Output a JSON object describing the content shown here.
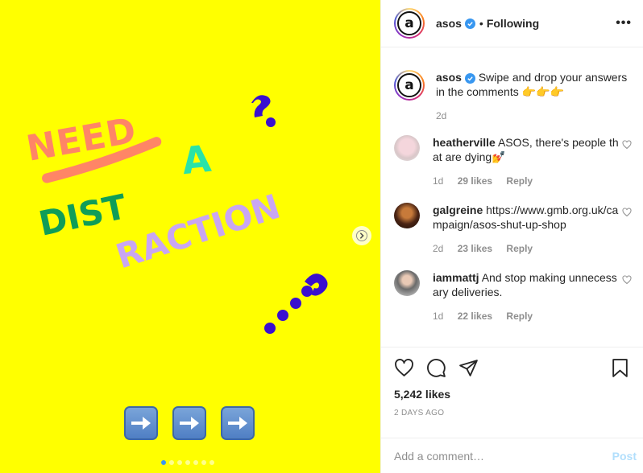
{
  "colors": {
    "media_bg": "#ffff00",
    "need": "#ff8566",
    "a": "#29e3a8",
    "dist": "#0f9d58",
    "raction": "#c9a6f2",
    "marks": "#3a0fcf",
    "link_blue": "#3897f0"
  },
  "media": {
    "words": [
      "NEED",
      "A",
      "DIST",
      "RACTION"
    ],
    "next_icon": "chevron-right-icon",
    "arrow_emoji_count": 3,
    "slide_count": 7,
    "active_slide": 1
  },
  "header": {
    "username": "asos",
    "separator": "•",
    "follow_status": "Following",
    "more": "•••"
  },
  "caption": {
    "username": "asos",
    "text": "Swipe and drop your answers in the comments 👉👉👉",
    "time": "2d"
  },
  "comments": [
    {
      "username": "heatherville",
      "text": "ASOS, there's people that are dying💅",
      "time": "1d",
      "likes": "29 likes",
      "reply": "Reply",
      "avatar_color": "#e8d9dc"
    },
    {
      "username": "galgreine",
      "text": "https://www.gmb.org.uk/campaign/asos-shut-up-shop",
      "time": "2d",
      "likes": "23 likes",
      "reply": "Reply",
      "avatar_color": "#5a2a14"
    },
    {
      "username": "iammattj",
      "text": "And stop making unnecessary deliveries.",
      "time": "1d",
      "likes": "22 likes",
      "reply": "Reply",
      "avatar_color": "#cfcfcf"
    }
  ],
  "actions": {
    "likes": "5,242 likes",
    "ago": "2 DAYS AGO"
  },
  "add_comment": {
    "placeholder": "Add a comment…",
    "post_label": "Post"
  }
}
